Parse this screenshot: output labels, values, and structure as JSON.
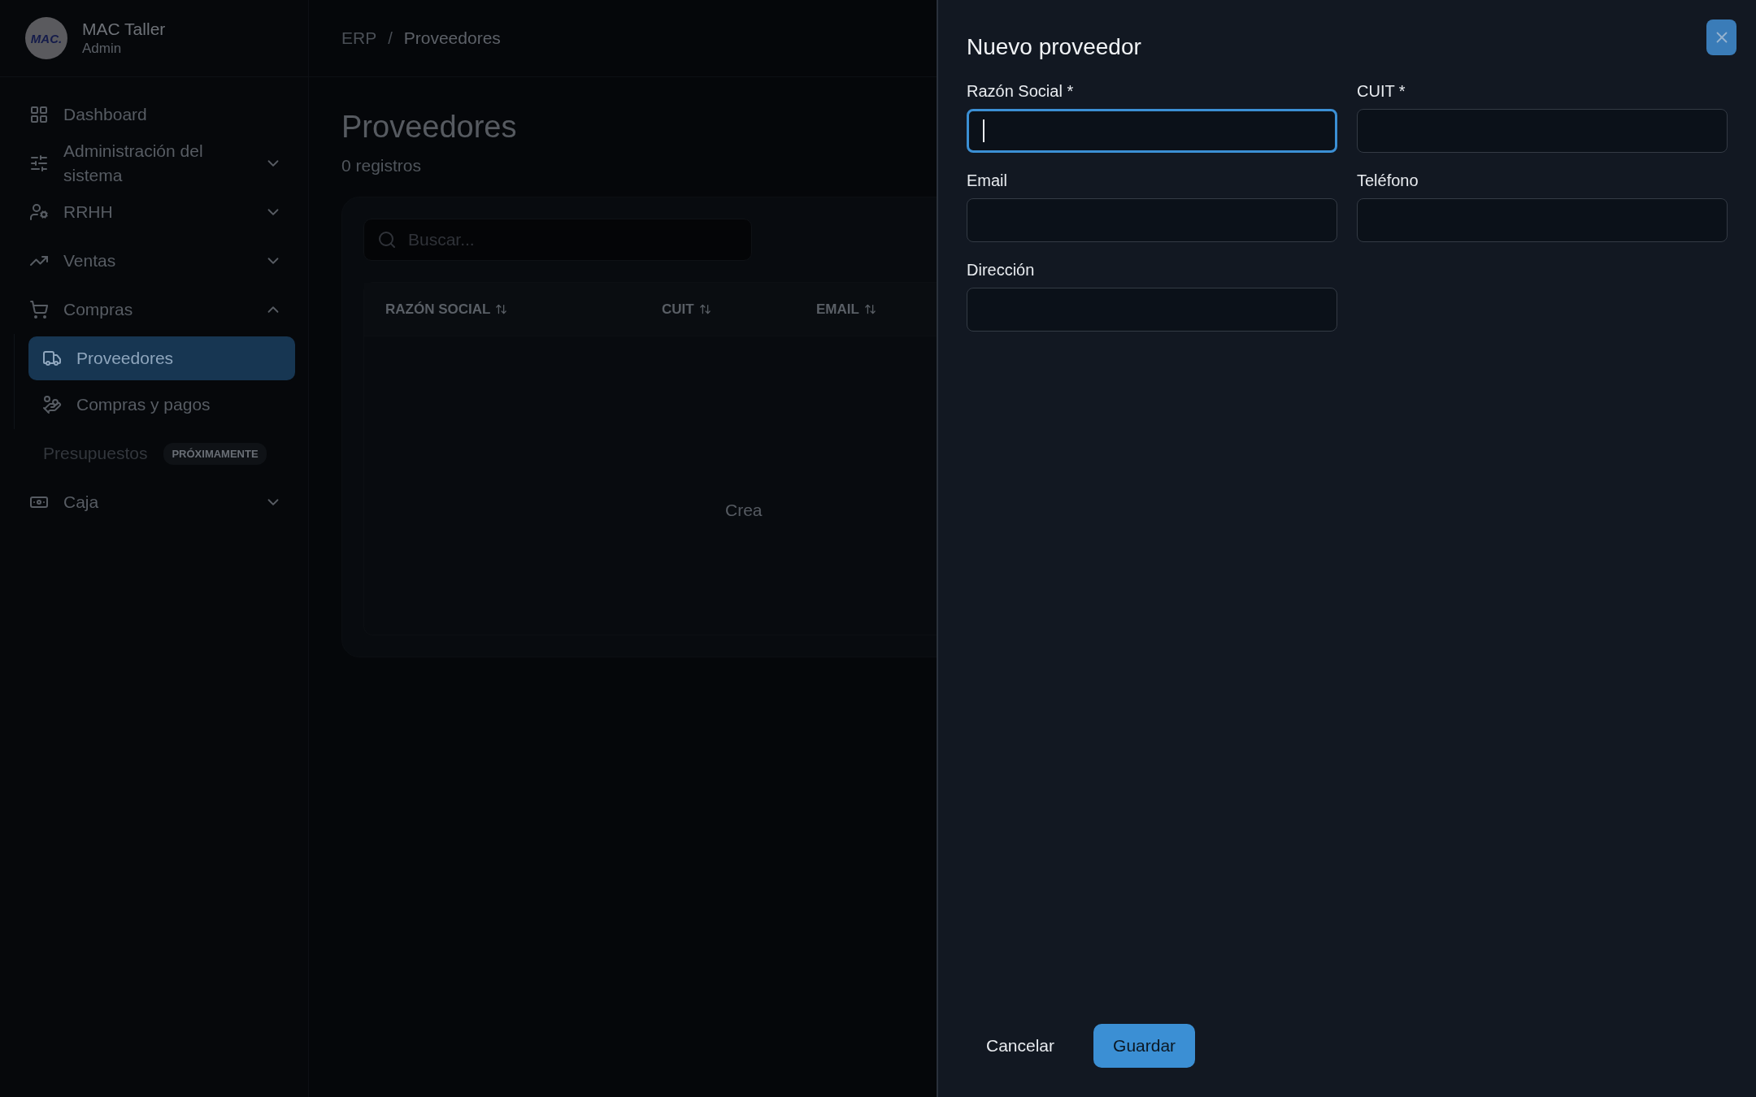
{
  "sidebar": {
    "logo_text": "MAC.",
    "brand": "MAC Taller",
    "role": "Admin",
    "items": [
      {
        "kind": "link",
        "label": "Dashboard",
        "selected": false
      },
      {
        "kind": "group",
        "label": "Administración del sistema",
        "expanded": false
      },
      {
        "kind": "group",
        "label": "RRHH",
        "expanded": false
      },
      {
        "kind": "group",
        "label": "Ventas",
        "expanded": false
      },
      {
        "kind": "group",
        "label": "Compras",
        "expanded": true,
        "children": [
          {
            "label": "Proveedores",
            "selected": true
          },
          {
            "label": "Compras y pagos",
            "selected": false
          }
        ]
      },
      {
        "kind": "soon",
        "label": "Presupuestos",
        "badge": "PRÓXIMAMENTE"
      },
      {
        "kind": "group",
        "label": "Caja",
        "expanded": false
      }
    ]
  },
  "breadcrumb": [
    "ERP",
    "Proveedores"
  ],
  "breadcrumb_separator": "/",
  "page": {
    "title": "Proveedores",
    "subtitle": "0 registros",
    "search": {
      "placeholder": "Buscar..."
    },
    "table": {
      "columns": [
        "RAZÓN SOCIAL",
        "CUIT",
        "EMAIL"
      ],
      "empty_text": "Crea"
    }
  },
  "drawer": {
    "title": "Nuevo proveedor",
    "fields": [
      {
        "label": "Razón Social *",
        "focused": true
      },
      {
        "label": "CUIT *",
        "focused": false
      },
      {
        "label": "Email",
        "focused": false
      },
      {
        "label": "Teléfono",
        "focused": false
      },
      {
        "label": "Dirección",
        "focused": false
      }
    ],
    "buttons": [
      {
        "label": "Cancelar",
        "kind": "ghost"
      },
      {
        "label": "Guardar",
        "kind": "primary"
      }
    ]
  }
}
